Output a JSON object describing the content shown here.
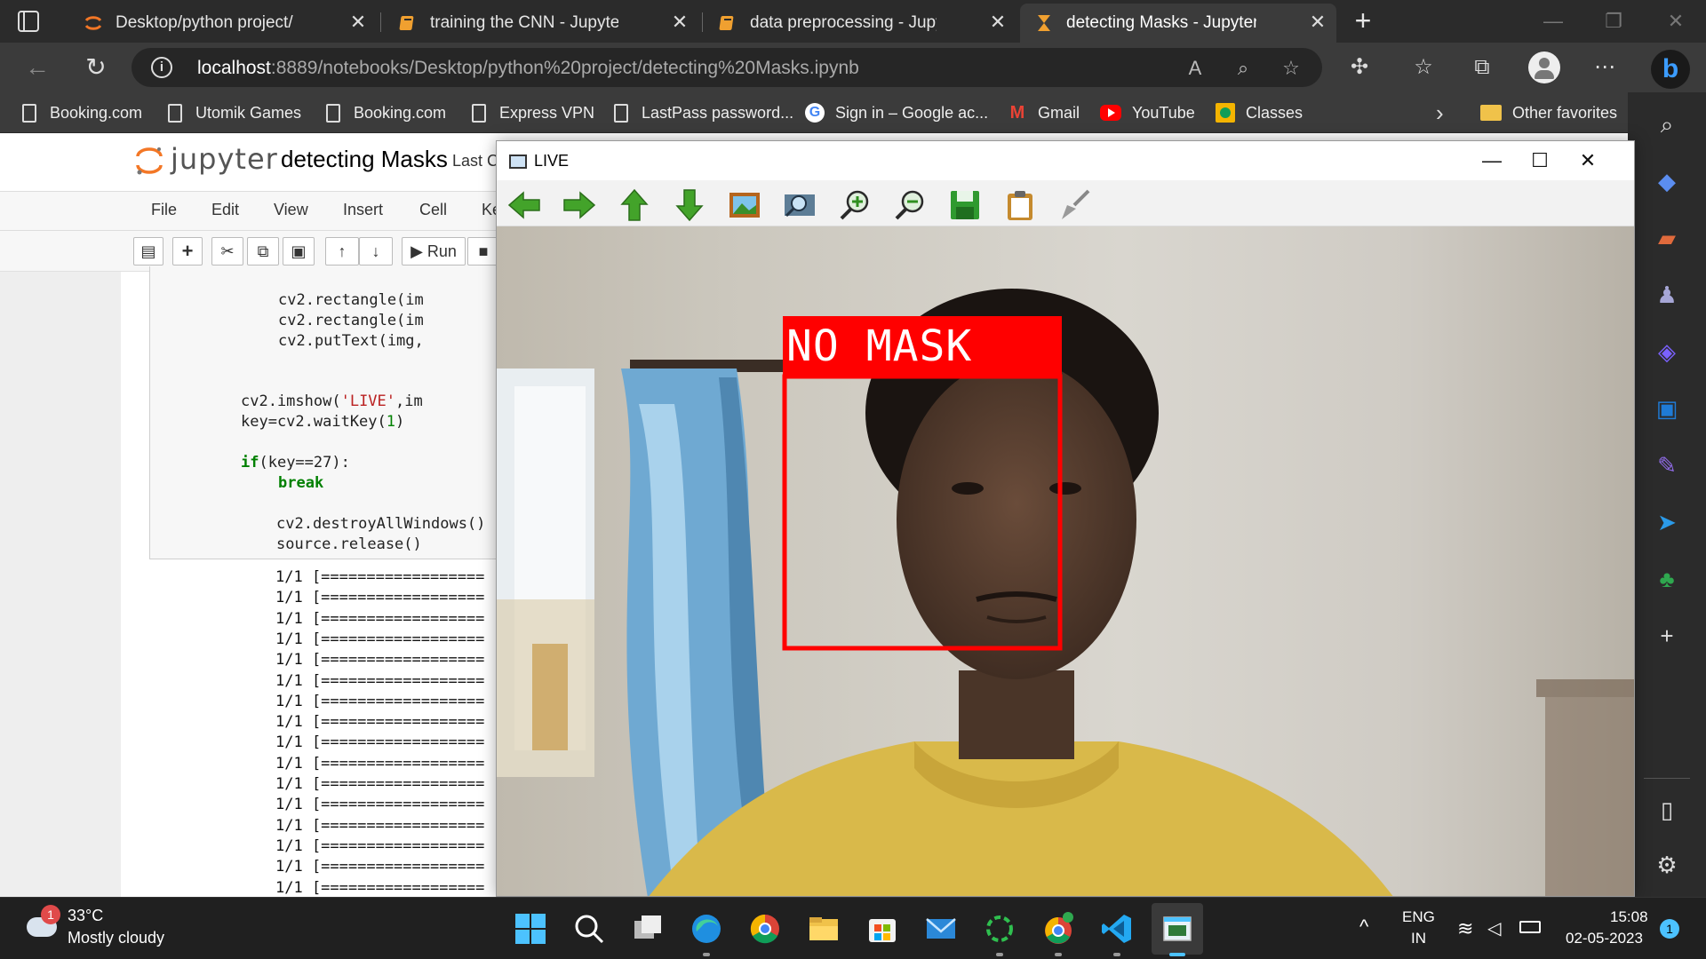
{
  "browser": {
    "tabs": [
      {
        "label": "Desktop/python project/",
        "icon": "jupyter-icon",
        "active": false
      },
      {
        "label": "training the CNN - Jupyter Noteb",
        "icon": "notebook-icon",
        "active": false
      },
      {
        "label": "data preprocessing - Jupyter Not",
        "icon": "notebook-icon",
        "active": false
      },
      {
        "label": "detecting Masks - Jupyter Noteb",
        "icon": "hourglass-icon",
        "active": true
      }
    ],
    "close_glyph": "✕",
    "new_tab_glyph": "+",
    "url": {
      "host": "localhost",
      "rest": ":8889/notebooks/Desktop/python%20project/detecting%20Masks.ipynb"
    },
    "favorites": [
      {
        "label": "Booking.com",
        "icon": "page-icon"
      },
      {
        "label": "Utomik Games",
        "icon": "page-icon"
      },
      {
        "label": "Booking.com",
        "icon": "page-icon"
      },
      {
        "label": "Express VPN",
        "icon": "page-icon"
      },
      {
        "label": "LastPass password...",
        "icon": "page-icon"
      },
      {
        "label": "Sign in – Google ac...",
        "icon": "google-icon"
      },
      {
        "label": "Gmail",
        "icon": "gmail-icon"
      },
      {
        "label": "YouTube",
        "icon": "youtube-icon"
      },
      {
        "label": "Classes",
        "icon": "classroom-icon"
      }
    ],
    "other_favorites": "Other favorites"
  },
  "jupyter": {
    "logo_text": "jupyter",
    "notebook_title": "detecting Masks",
    "last_checkpoint": "Last C",
    "menu": [
      "File",
      "Edit",
      "View",
      "Insert",
      "Cell",
      "Ke"
    ],
    "run_label": "Run",
    "code_lines": [
      {
        "indent": 2,
        "text": "cv2.rectangle(im"
      },
      {
        "indent": 2,
        "text": "cv2.rectangle(im"
      },
      {
        "indent": 2,
        "text": "cv2.putText(img,"
      },
      {
        "indent": 1,
        "text_pre": "cv2.imshow(",
        "text_str": "'LIVE'",
        "text_post": ",im"
      },
      {
        "indent": 1,
        "text_pre": "key=cv2.waitKey(",
        "text_num": "1",
        "text_post": ")"
      },
      {
        "indent": 1,
        "text_kw": "if",
        "text_post": "(key==27):"
      },
      {
        "indent": 2,
        "text_kw": "break"
      },
      {
        "indent": 0,
        "text": "cv2.destroyAllWindows()"
      },
      {
        "indent": 0,
        "text": "source.release()"
      }
    ],
    "output_line": "1/1 [==================",
    "output_count": 16
  },
  "live_window": {
    "title": "LIVE",
    "label": "NO MASK",
    "label_bg": "#ff0000",
    "tools": [
      "arrow-left-icon",
      "arrow-right-icon",
      "arrow-up-icon",
      "arrow-down-icon",
      "image-icon",
      "zoom-fit-icon",
      "zoom-in-icon",
      "zoom-out-icon",
      "save-icon",
      "copy-icon",
      "brush-icon"
    ]
  },
  "taskbar": {
    "weather_temp": "33°C",
    "weather_desc": "Mostly cloudy",
    "weather_badge": "1",
    "lang_1": "ENG",
    "lang_2": "IN",
    "time": "15:08",
    "date": "02-05-2023",
    "notif_badge": "1"
  }
}
